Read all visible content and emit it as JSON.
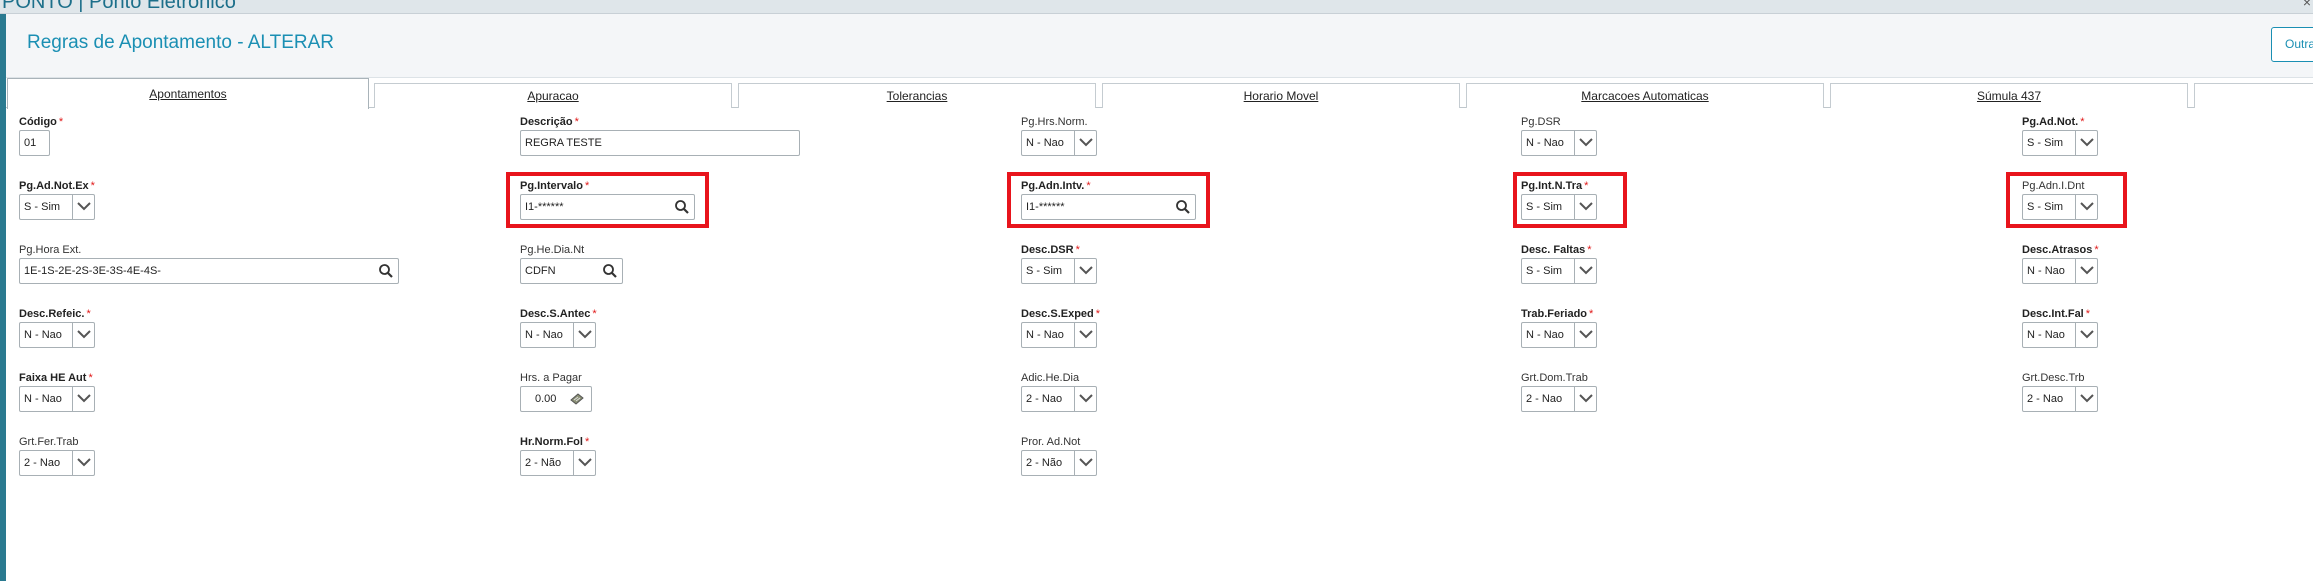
{
  "window": {
    "title": "PONTO | Ponto Eletrônico",
    "close": "×"
  },
  "header": {
    "title": "Regras de Apontamento - ALTERAR",
    "other_button": "Outras Ações"
  },
  "tabs": [
    {
      "label": "Apontamentos"
    },
    {
      "label": "Apuracao"
    },
    {
      "label": "Tolerancias"
    },
    {
      "label": "Horario Movel"
    },
    {
      "label": "Marcacoes Automaticas"
    },
    {
      "label": "Súmula 437"
    }
  ],
  "form": {
    "codigo": {
      "label": "Código",
      "value": "01"
    },
    "descricao": {
      "label": "Descrição",
      "value": "REGRA TESTE"
    },
    "pg_hrs_norm": {
      "label": "Pg.Hrs.Norm.",
      "value": "N - Nao"
    },
    "pg_dsr": {
      "label": "Pg.DSR",
      "value": "N - Nao"
    },
    "pg_ad_not": {
      "label": "Pg.Ad.Not.",
      "value": "S - Sim"
    },
    "pg_ad_not_ex": {
      "label": "Pg.Ad.Not.Ex",
      "value": "S - Sim"
    },
    "pg_intervalo": {
      "label": "Pg.Intervalo",
      "value": "I1-******"
    },
    "pg_adn_intv": {
      "label": "Pg.Adn.Intv.",
      "value": "I1-******"
    },
    "pg_int_n_tra": {
      "label": "Pg.Int.N.Tra",
      "value": "S - Sim"
    },
    "pg_adn_i_dnt": {
      "label": "Pg.Adn.I.Dnt",
      "value": "S - Sim"
    },
    "pg_hora_ext": {
      "label": "Pg.Hora Ext.",
      "value": "1E-1S-2E-2S-3E-3S-4E-4S-"
    },
    "pg_he_dia_nt": {
      "label": "Pg.He.Dia.Nt",
      "value": "CDFN"
    },
    "desc_dsr": {
      "label": "Desc.DSR",
      "value": "S - Sim"
    },
    "desc_faltas": {
      "label": "Desc. Faltas",
      "value": "S - Sim"
    },
    "desc_atrasos": {
      "label": "Desc.Atrasos",
      "value": "N - Nao"
    },
    "desc_refeic": {
      "label": "Desc.Refeic.",
      "value": "N - Nao"
    },
    "desc_s_antec": {
      "label": "Desc.S.Antec",
      "value": "N - Nao"
    },
    "desc_s_exped": {
      "label": "Desc.S.Exped",
      "value": "N - Nao"
    },
    "trab_feriado": {
      "label": "Trab.Feriado",
      "value": "N - Nao"
    },
    "desc_int_fal": {
      "label": "Desc.Int.Fal",
      "value": "N - Nao"
    },
    "faixa_he_aut": {
      "label": "Faixa HE Aut",
      "value": "N - Nao"
    },
    "hrs_a_pagar": {
      "label": "Hrs. a Pagar",
      "value": "0.00"
    },
    "adic_he_dia": {
      "label": "Adic.He.Dia",
      "value": "2 - Nao"
    },
    "grt_dom_trab": {
      "label": "Grt.Dom.Trab",
      "value": "2 - Nao"
    },
    "grt_desc_trb": {
      "label": "Grt.Desc.Trb",
      "value": "2 - Nao"
    },
    "grt_fer_trab": {
      "label": "Grt.Fer.Trab",
      "value": "2 - Nao"
    },
    "hr_norm_fol": {
      "label": "Hr.Norm.Fol",
      "value": "2 - Não"
    },
    "pror_ad_not": {
      "label": "Pror. Ad.Not",
      "value": "2 - Não"
    }
  },
  "colors": {
    "accent": "#1a8fb3",
    "required": "#e01818",
    "highlight": "#e8141c"
  },
  "icons": [
    "search-icon",
    "chevron-down-icon",
    "calculator-icon"
  ]
}
